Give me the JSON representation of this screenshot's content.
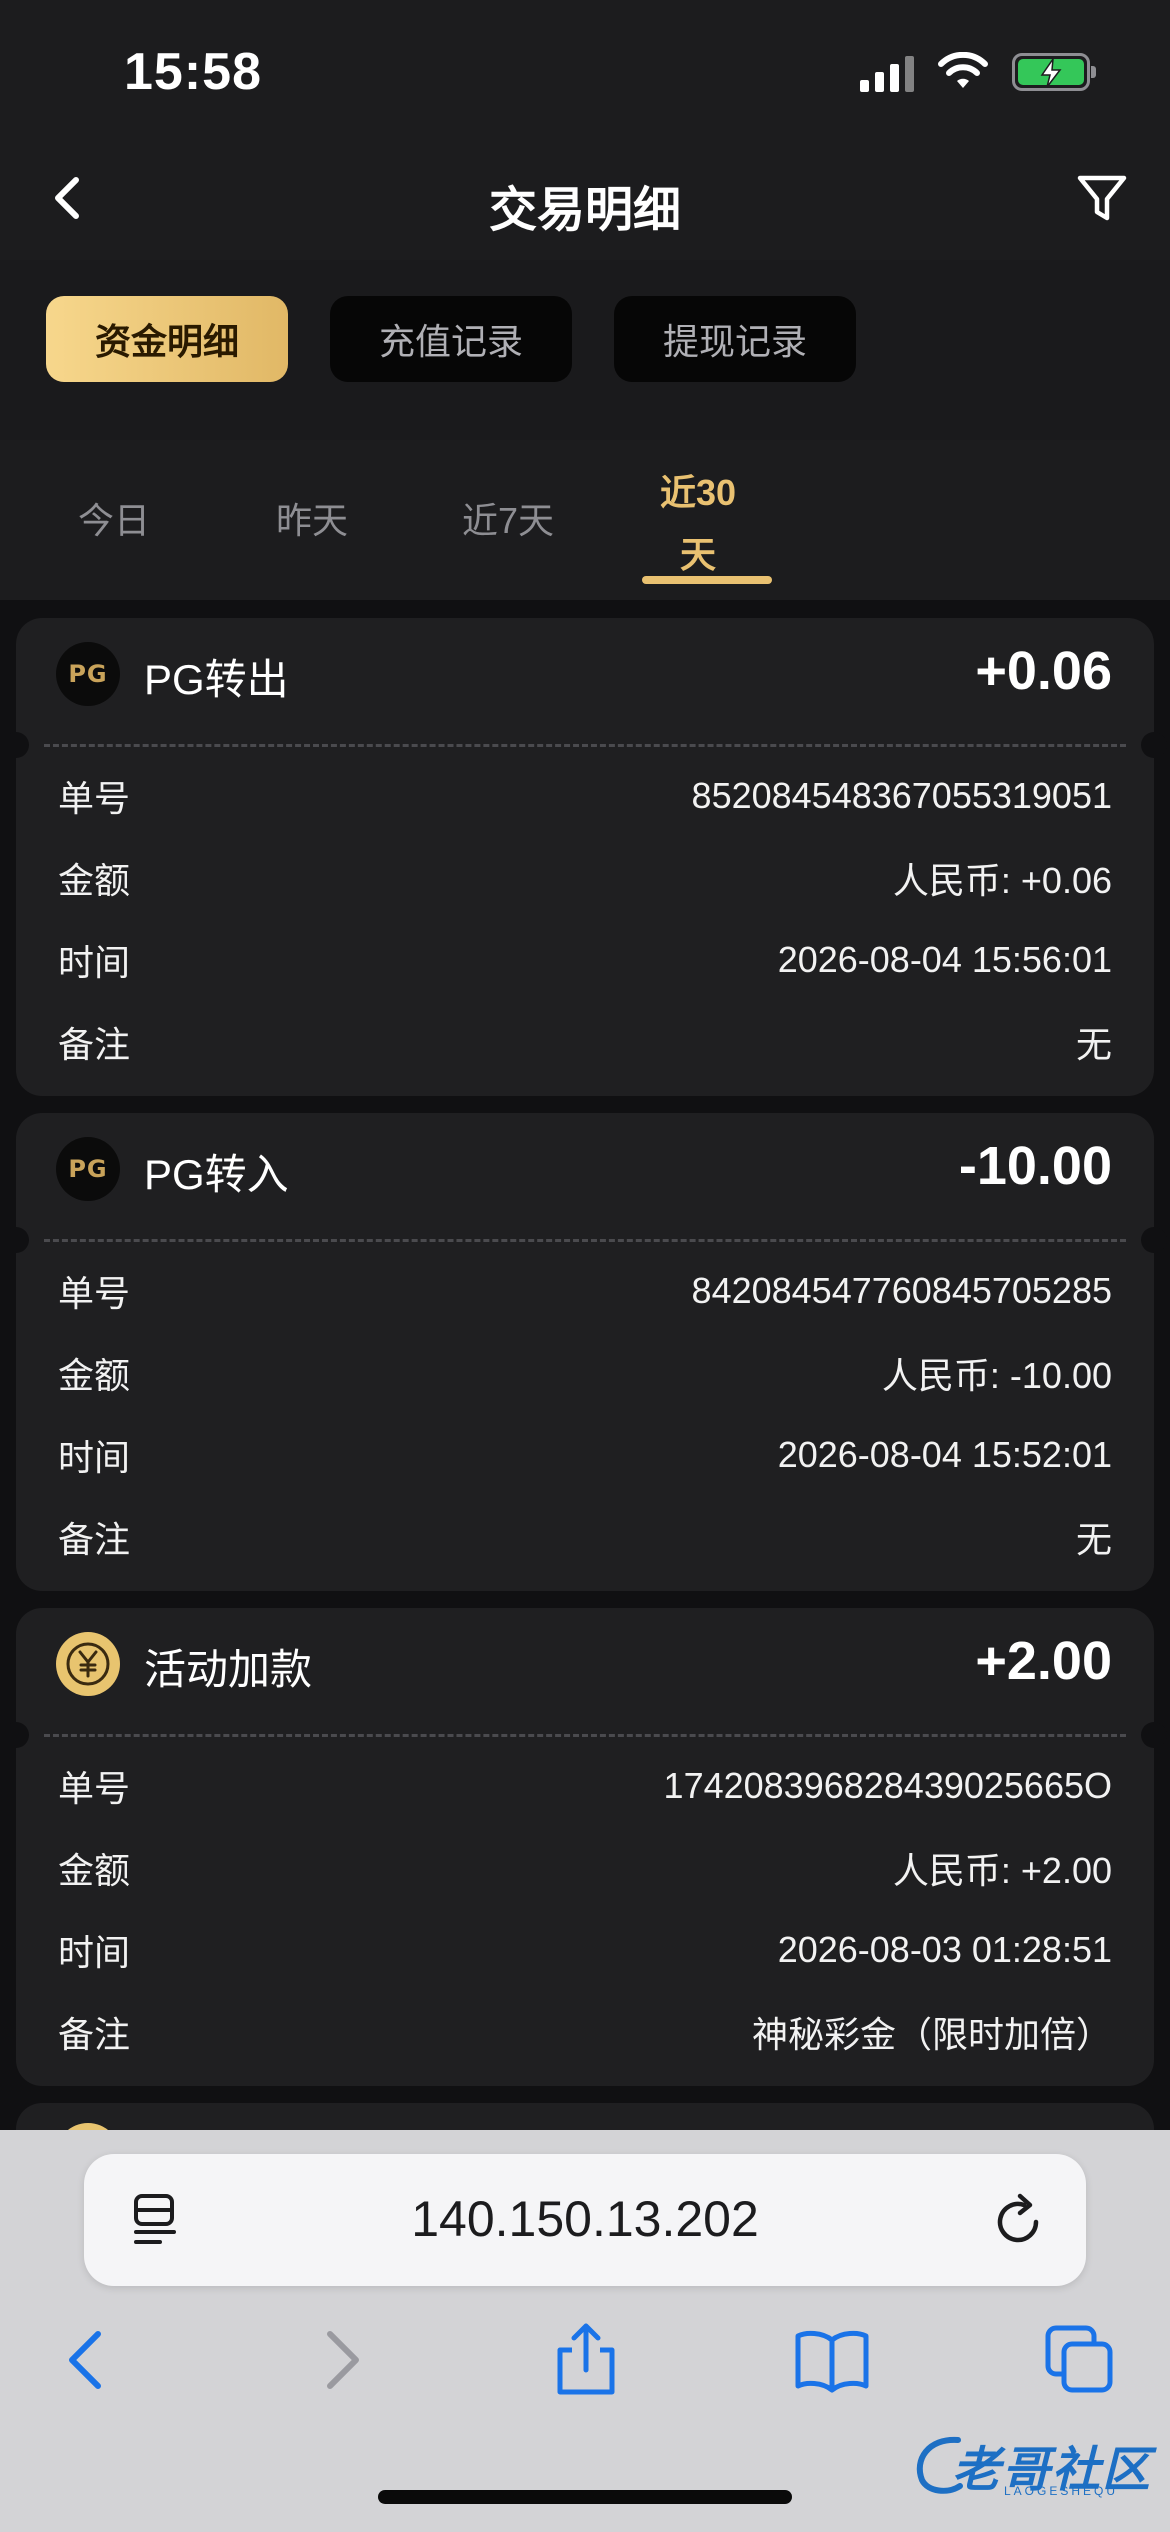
{
  "status": {
    "time": "15:58"
  },
  "nav": {
    "title": "交易明细"
  },
  "tabs": [
    "资金明细",
    "充值记录",
    "提现记录"
  ],
  "periods": {
    "today": "今日",
    "yesterday": "昨天",
    "week": "近7天",
    "month_line1": "近30",
    "month_line2": "天"
  },
  "labels": {
    "order": "单号",
    "amount": "金额",
    "time": "时间",
    "remark": "备注"
  },
  "records": [
    {
      "logo": "PG",
      "title": "PG转出",
      "amount": "+0.06",
      "order": "852084548367055319051",
      "amount_detail": "人民币: +0.06",
      "time": "2026-08-04 15:56:01",
      "remark": "无"
    },
    {
      "logo": "PG",
      "title": "PG转入",
      "amount": "-10.00",
      "order": "842084547760845705285",
      "amount_detail": "人民币: -10.00",
      "time": "2026-08-04 15:52:01",
      "remark": "无"
    },
    {
      "logo": "coin",
      "title": "活动加款",
      "amount": "+2.00",
      "order": "174208396828439025665O",
      "amount_detail": "人民币: +2.00",
      "time": "2026-08-03 01:28:51",
      "remark": "神秘彩金（限时加倍）"
    }
  ],
  "browser": {
    "url": "140.150.13.202"
  },
  "watermark": {
    "text": "老哥社区",
    "sub": "LAOGESHEQU"
  },
  "colors": {
    "accent": "#e9c171",
    "background": "#1a1a1c",
    "card": "#1f1f21",
    "battery": "#34c759",
    "browser_blue": "#1a73e8"
  }
}
